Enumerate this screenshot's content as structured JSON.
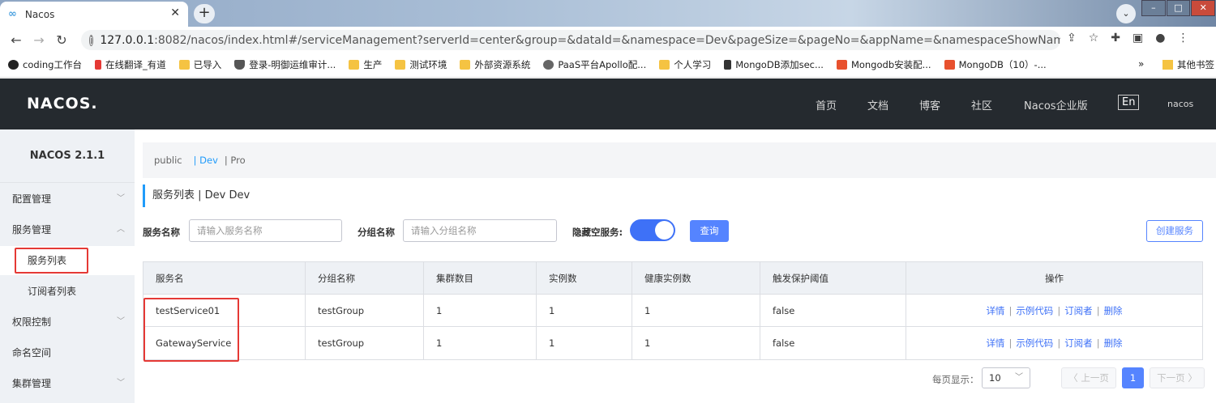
{
  "browser": {
    "tab_title": "Nacos",
    "url_host": "127.0.0.1",
    "url_rest": ":8082/nacos/index.html#/serviceManagement?serverId=center&group=&dataId=&namespace=Dev&pageSize=&pageNo=&appName=&namespaceShowName=Dev",
    "bookmarks": [
      "coding工作台",
      "在线翻译_有道",
      "已导入",
      "登录-明御运维审计...",
      "生产",
      "测试环境",
      "外部资源系统",
      "PaaS平台Apollo配...",
      "个人学习",
      "MongoDB添加sec...",
      "Mongodb安装配...",
      "MongoDB（10）-..."
    ],
    "bookmarks_more": "»",
    "other_bookmarks": "其他书签"
  },
  "header": {
    "logo": "NACOS.",
    "nav": [
      "首页",
      "文档",
      "博客",
      "社区",
      "Nacos企业版"
    ],
    "lang": "En",
    "user": "nacos"
  },
  "sidebar": {
    "version": "NACOS 2.1.1",
    "items": [
      {
        "label": "配置管理"
      },
      {
        "label": "服务管理"
      },
      {
        "label": "服务列表"
      },
      {
        "label": "订阅者列表"
      },
      {
        "label": "权限控制"
      },
      {
        "label": "命名空间"
      },
      {
        "label": "集群管理"
      }
    ]
  },
  "namespaces": [
    "public",
    "| Dev",
    "| Pro"
  ],
  "page_title": "服务列表  |  Dev  Dev",
  "search": {
    "service_label": "服务名称",
    "service_placeholder": "请输入服务名称",
    "group_label": "分组名称",
    "group_placeholder": "请输入分组名称",
    "hide_empty_label": "隐藏空服务:",
    "query_button": "查询",
    "create_button": "创建服务"
  },
  "table": {
    "headers": [
      "服务名",
      "分组名称",
      "集群数目",
      "实例数",
      "健康实例数",
      "触发保护阈值",
      "操作"
    ],
    "rows": [
      {
        "name": "testService01",
        "group": "testGroup",
        "clusters": "1",
        "instances": "1",
        "healthy": "1",
        "threshold": "false"
      },
      {
        "name": "GatewayService",
        "group": "testGroup",
        "clusters": "1",
        "instances": "1",
        "healthy": "1",
        "threshold": "false"
      }
    ],
    "ops": [
      "详情",
      "示例代码",
      "订阅者",
      "删除"
    ]
  },
  "pagination": {
    "page_size_label": "每页显示：",
    "page_size": "10",
    "prev": "〈 上一页",
    "current": "1",
    "next": "下一页 〉"
  }
}
